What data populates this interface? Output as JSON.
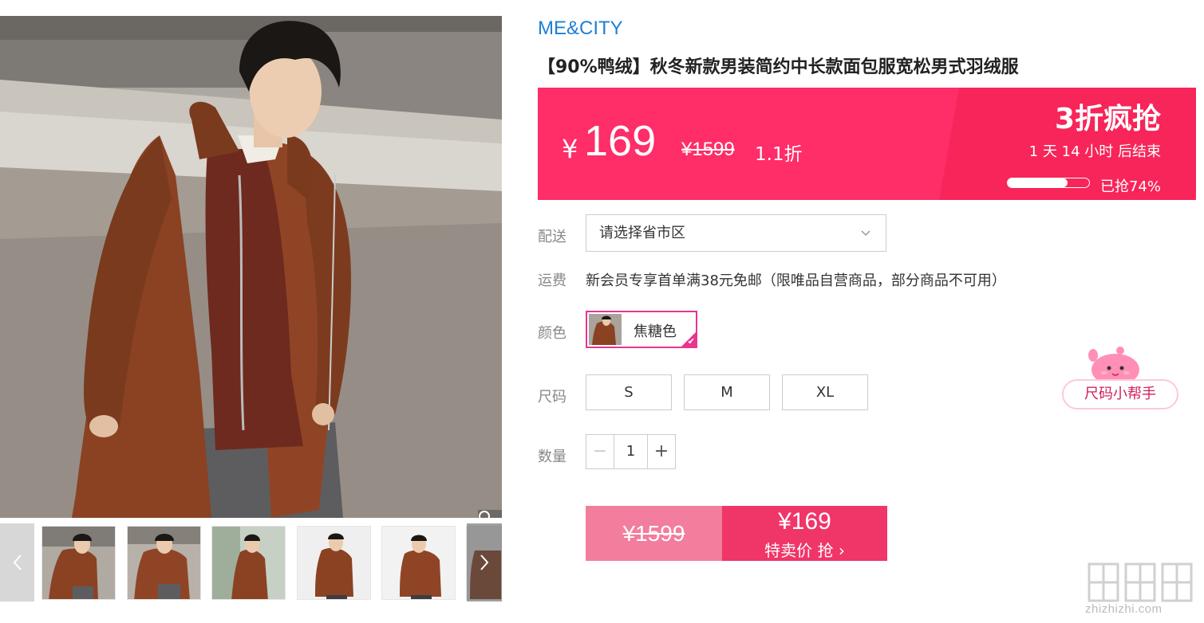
{
  "gallery": {
    "main_alt": "model wearing caramel down coat",
    "thumbs_count": 6,
    "prev_icon": "chevron-left-icon",
    "next_icon": "chevron-right-icon",
    "zoom_icon": "magnifier-icon"
  },
  "product": {
    "brand": "ME&CITY",
    "title": "【90%鸭绒】秋冬新款男装简约中长款面包服宽松男式羽绒服"
  },
  "promo": {
    "currency": "¥",
    "price": "169",
    "original_price": "¥1599",
    "discount": "1.1折",
    "tag": "3折疯抢",
    "countdown": "1  天 14 小时 后结束",
    "sold_label": "已抢74%",
    "sold_fraction": 0.74,
    "bg_color": "#ff2d68"
  },
  "delivery": {
    "label": "配送",
    "placeholder": "请选择省市区"
  },
  "shipping": {
    "label": "运费",
    "text": "新会员专享首单满38元免邮（限唯品自营商品，部分商品不可用）"
  },
  "color": {
    "label": "颜色",
    "selected": "焦糖色"
  },
  "size": {
    "label": "尺码",
    "options": [
      "S",
      "M",
      "XL"
    ],
    "helper": "尺码小帮手"
  },
  "quantity": {
    "label": "数量",
    "minus": "−",
    "value": "1",
    "plus": "+"
  },
  "buy": {
    "original_price": "¥1599",
    "price": "¥169",
    "action": "特卖价 抢 ›"
  },
  "watermark": {
    "text": "zhizhizhi.com"
  }
}
